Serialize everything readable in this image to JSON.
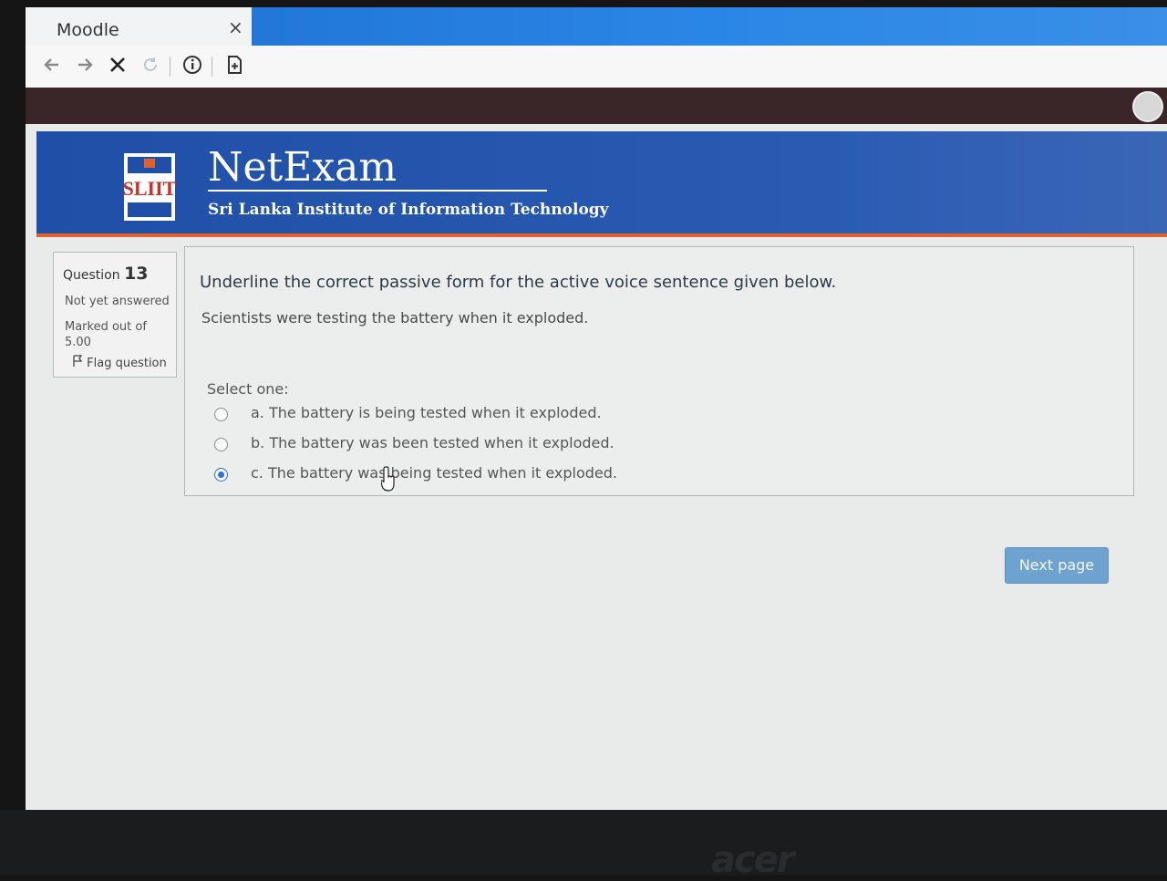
{
  "browser": {
    "tab_title": "Moodle",
    "tab_close_glyph": "×",
    "toolbar_icons": [
      "back-icon",
      "forward-icon",
      "stop-icon",
      "reload-icon",
      "info-icon",
      "reader-icon"
    ]
  },
  "banner": {
    "logo_text": "SLIIT",
    "title": "NetExam",
    "subtitle": "Sri Lanka Institute of Information Technology"
  },
  "question_info": {
    "label": "Question",
    "number": "13",
    "state": "Not yet answered",
    "marked_line1": "Marked out of",
    "marked_line2": "5.00",
    "flag_label": "Flag question"
  },
  "question": {
    "instruction": "Underline the correct passive form for the active voice sentence given below.",
    "sentence": "Scientists were testing the battery when it exploded.",
    "select_label": "Select one:",
    "options": [
      {
        "label": "a. The battery is being tested when it exploded.",
        "selected": false
      },
      {
        "label": "b. The battery was been tested when it exploded.",
        "selected": false
      },
      {
        "label": "c. The battery was being tested when it exploded.",
        "selected": true
      }
    ]
  },
  "navigation": {
    "next_label": "Next page"
  },
  "device": {
    "brand": "acer"
  },
  "colors": {
    "banner_blue": "#2a5bb3",
    "banner_accent": "#e0612e",
    "next_button": "#6fa3cf",
    "radio_selected": "#2f6fd6"
  }
}
